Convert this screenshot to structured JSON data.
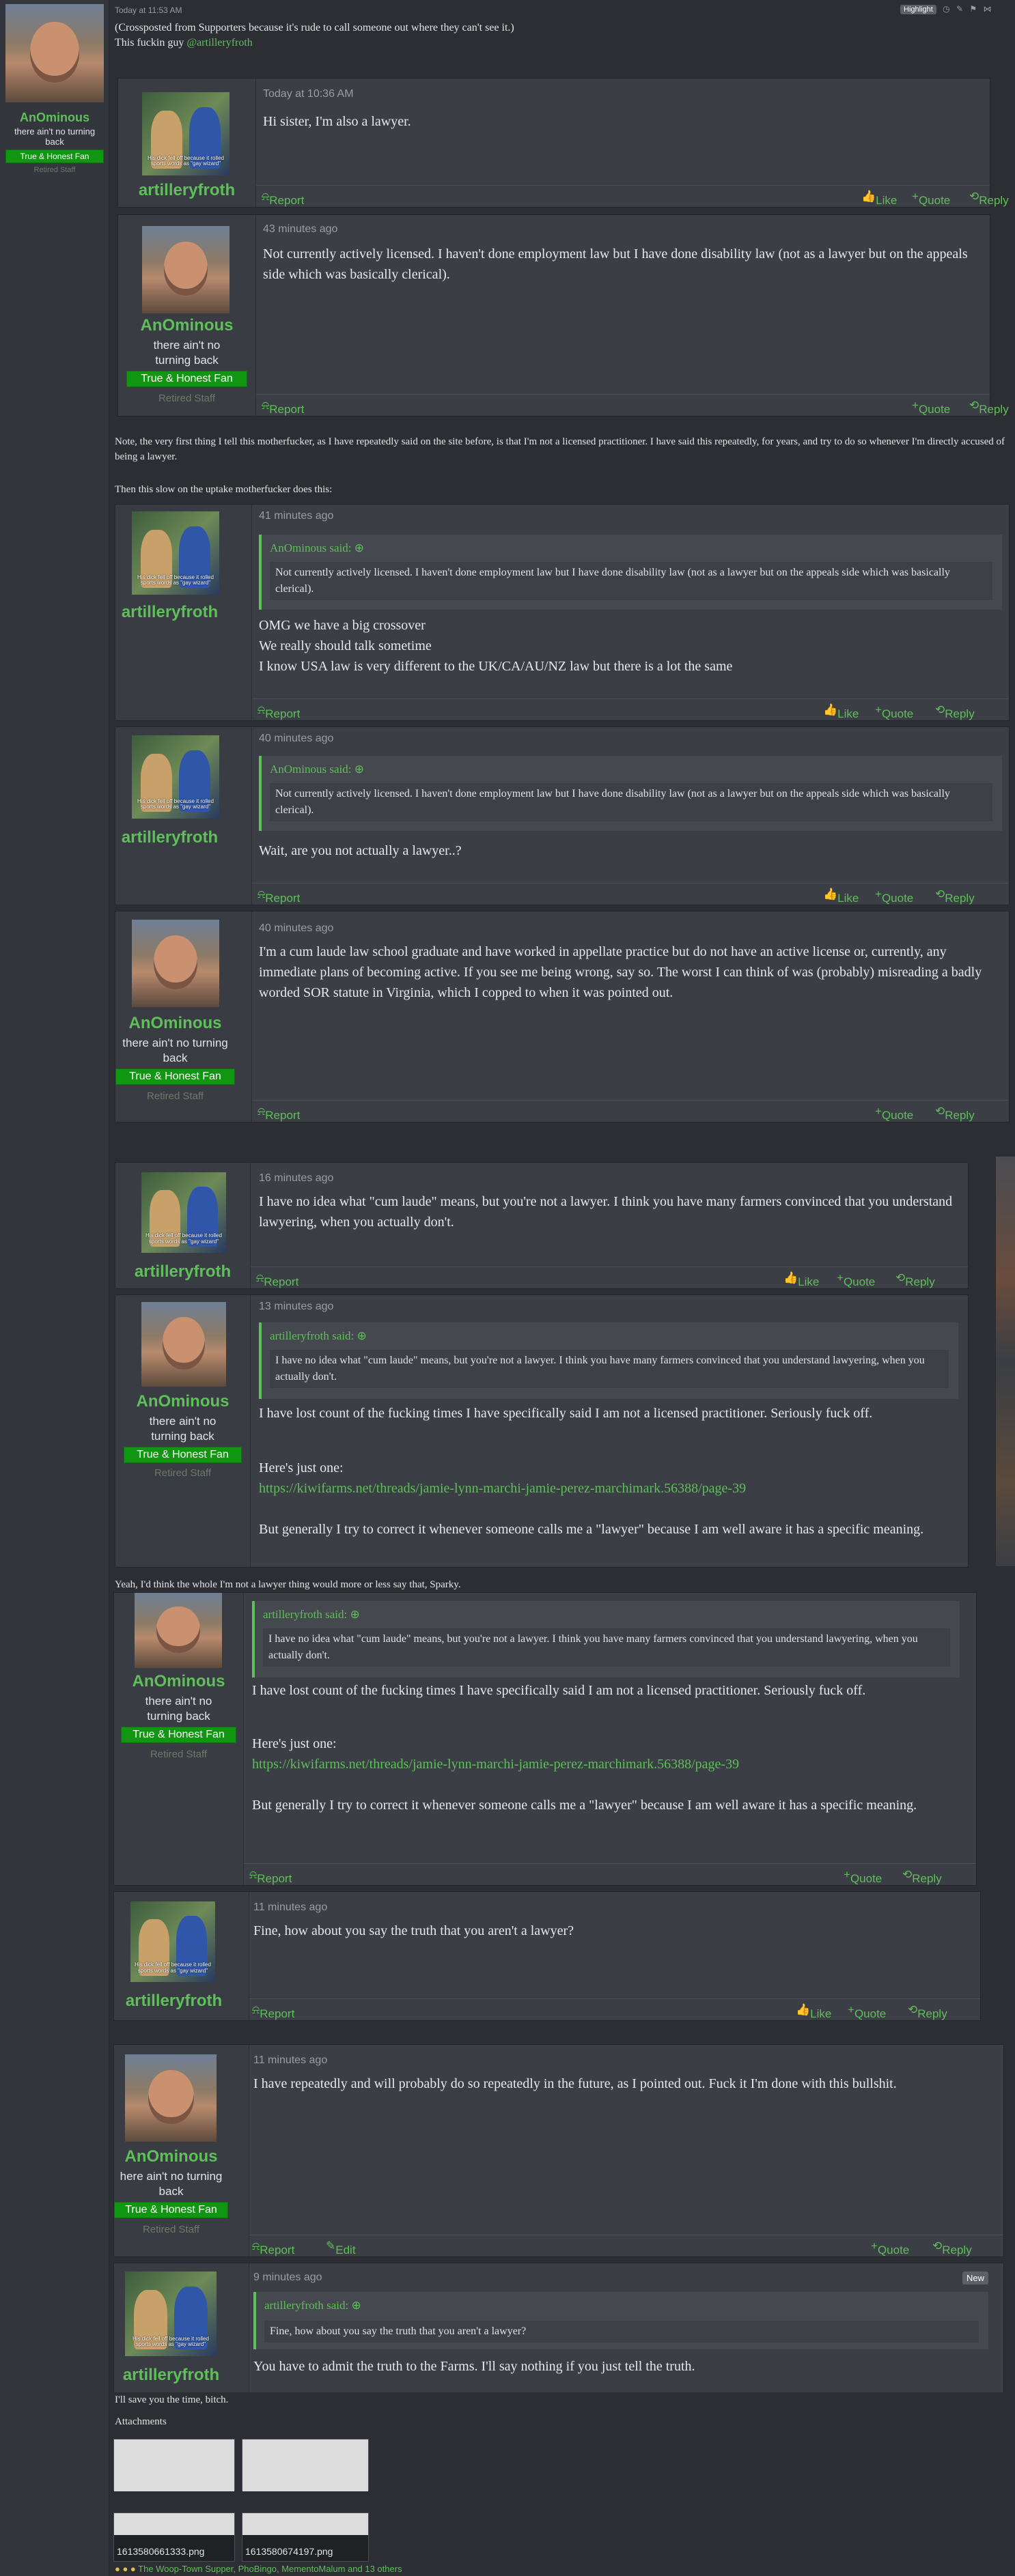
{
  "top": {
    "date": "Today at 11:53 AM",
    "highlight": "Highlight",
    "line1": "(Crossposted from Supporters because it's rude to call someone out where they can't see it.)",
    "line2": "This fuckin guy ",
    "mention": "@artilleryfroth"
  },
  "anom": {
    "name": "AnOminous",
    "title": "there ain't no turning back",
    "banner": "True & Honest Fan",
    "staff": "Retired Staff"
  },
  "arty": {
    "name": "artilleryfroth",
    "avatar_caption": "His dick fell off because it rolled sports words as \"gay wizard\""
  },
  "actions": {
    "report": "Report",
    "like": "Like",
    "quote": "Quote",
    "reply": "Reply",
    "edit": "Edit"
  },
  "posts": [
    {
      "date": "Today at 10:36 AM",
      "body": "Hi sister, I'm also a lawyer."
    },
    {
      "date": "43 minutes ago",
      "body": "Not currently actively licensed. I haven't done employment law but I have done disability law (not as a lawyer but on the appeals side which was basically clerical)."
    },
    {
      "date": "41 minutes ago",
      "quote_head": "AnOminous said:",
      "quote_body": "Not currently actively licensed. I haven't done employment law but I have done disability law (not as a lawyer but on the appeals side which was basically clerical).",
      "l1": "OMG we have a big crossover",
      "l2": "We really should talk sometime",
      "l3": "I know USA law is very different to the UK/CA/AU/NZ law but there is a lot the same"
    },
    {
      "date": "40 minutes ago",
      "quote_head": "AnOminous said:",
      "quote_body": "Not currently actively licensed. I haven't done employment law but I have done disability law (not as a lawyer but on the appeals side which was basically clerical).",
      "body": "Wait, are you not actually a lawyer..?"
    },
    {
      "date": "40 minutes ago",
      "body": "I'm a cum laude law school graduate and have worked in appellate practice but do not have an active license or, currently, any immediate plans of becoming active. If you see me being wrong, say so. The worst I can think of was (probably) misreading a badly worded SOR statute in Virginia, which I copped to when it was pointed out."
    },
    {
      "date": "16 minutes ago",
      "body": "I have no idea what \"cum laude\" means, but you're not a lawyer. I think you have many farmers convinced that you understand lawyering, when you actually don't."
    },
    {
      "date": "13 minutes ago",
      "quote_head": "artilleryfroth said:",
      "quote_body": "I have no idea what \"cum laude\" means, but you're not a lawyer. I think you have many farmers convinced that you understand lawyering, when you actually don't.",
      "p1": "I have lost count of the fucking times I have specifically said I am not a licensed practitioner. Seriously fuck off.",
      "p2": "Here's just one:",
      "link": "https://kiwifarms.net/threads/jamie-lynn-marchi-jamie-perez-marchimark.56388/page-39",
      "p3": "But generally I try to correct it whenever someone calls me a \"lawyer\" because I am well aware it has a specific meaning."
    },
    {
      "date": "11 minutes ago",
      "body": "Fine, how about you say the truth that you aren't a lawyer?"
    },
    {
      "date": "11 minutes ago",
      "title": "here ain't no turning back",
      "body": "I have repeatedly and will probably do so repeatedly in the future, as I pointed out. Fuck it I'm done with this bullshit."
    },
    {
      "date": "9 minutes ago",
      "new": "New",
      "quote_head": "artilleryfroth said:",
      "quote_body": "Fine, how about you say the truth that you aren't a lawyer?",
      "body": "You have to admit the truth to the Farms. I'll say nothing if you just tell the truth."
    }
  ],
  "notes": {
    "n1": "Note, the very first thing I tell this motherfucker, as I have repeatedly said on the site before, is that I'm not a licensed practitioner. I have said this repeatedly, for years, and try to do so whenever I'm directly accused of being a lawyer.",
    "n2": "Then this slow on the uptake motherfucker does this:",
    "n3": "Yeah, I'd think the whole I'm not a lawyer thing would more or less say that, Sparky.",
    "n4": "I'll save you the time, bitch.",
    "attachments": "Attachments",
    "file1": "1613580661333.png",
    "file2": "1613580674197.png",
    "reactions": "The Woop-Town Supper, PhoBingo, MementoMalum and 13 others"
  },
  "colors": {
    "accent": "#5fbf5a",
    "banner": "#119611",
    "post_bg": "#3b3e44"
  }
}
